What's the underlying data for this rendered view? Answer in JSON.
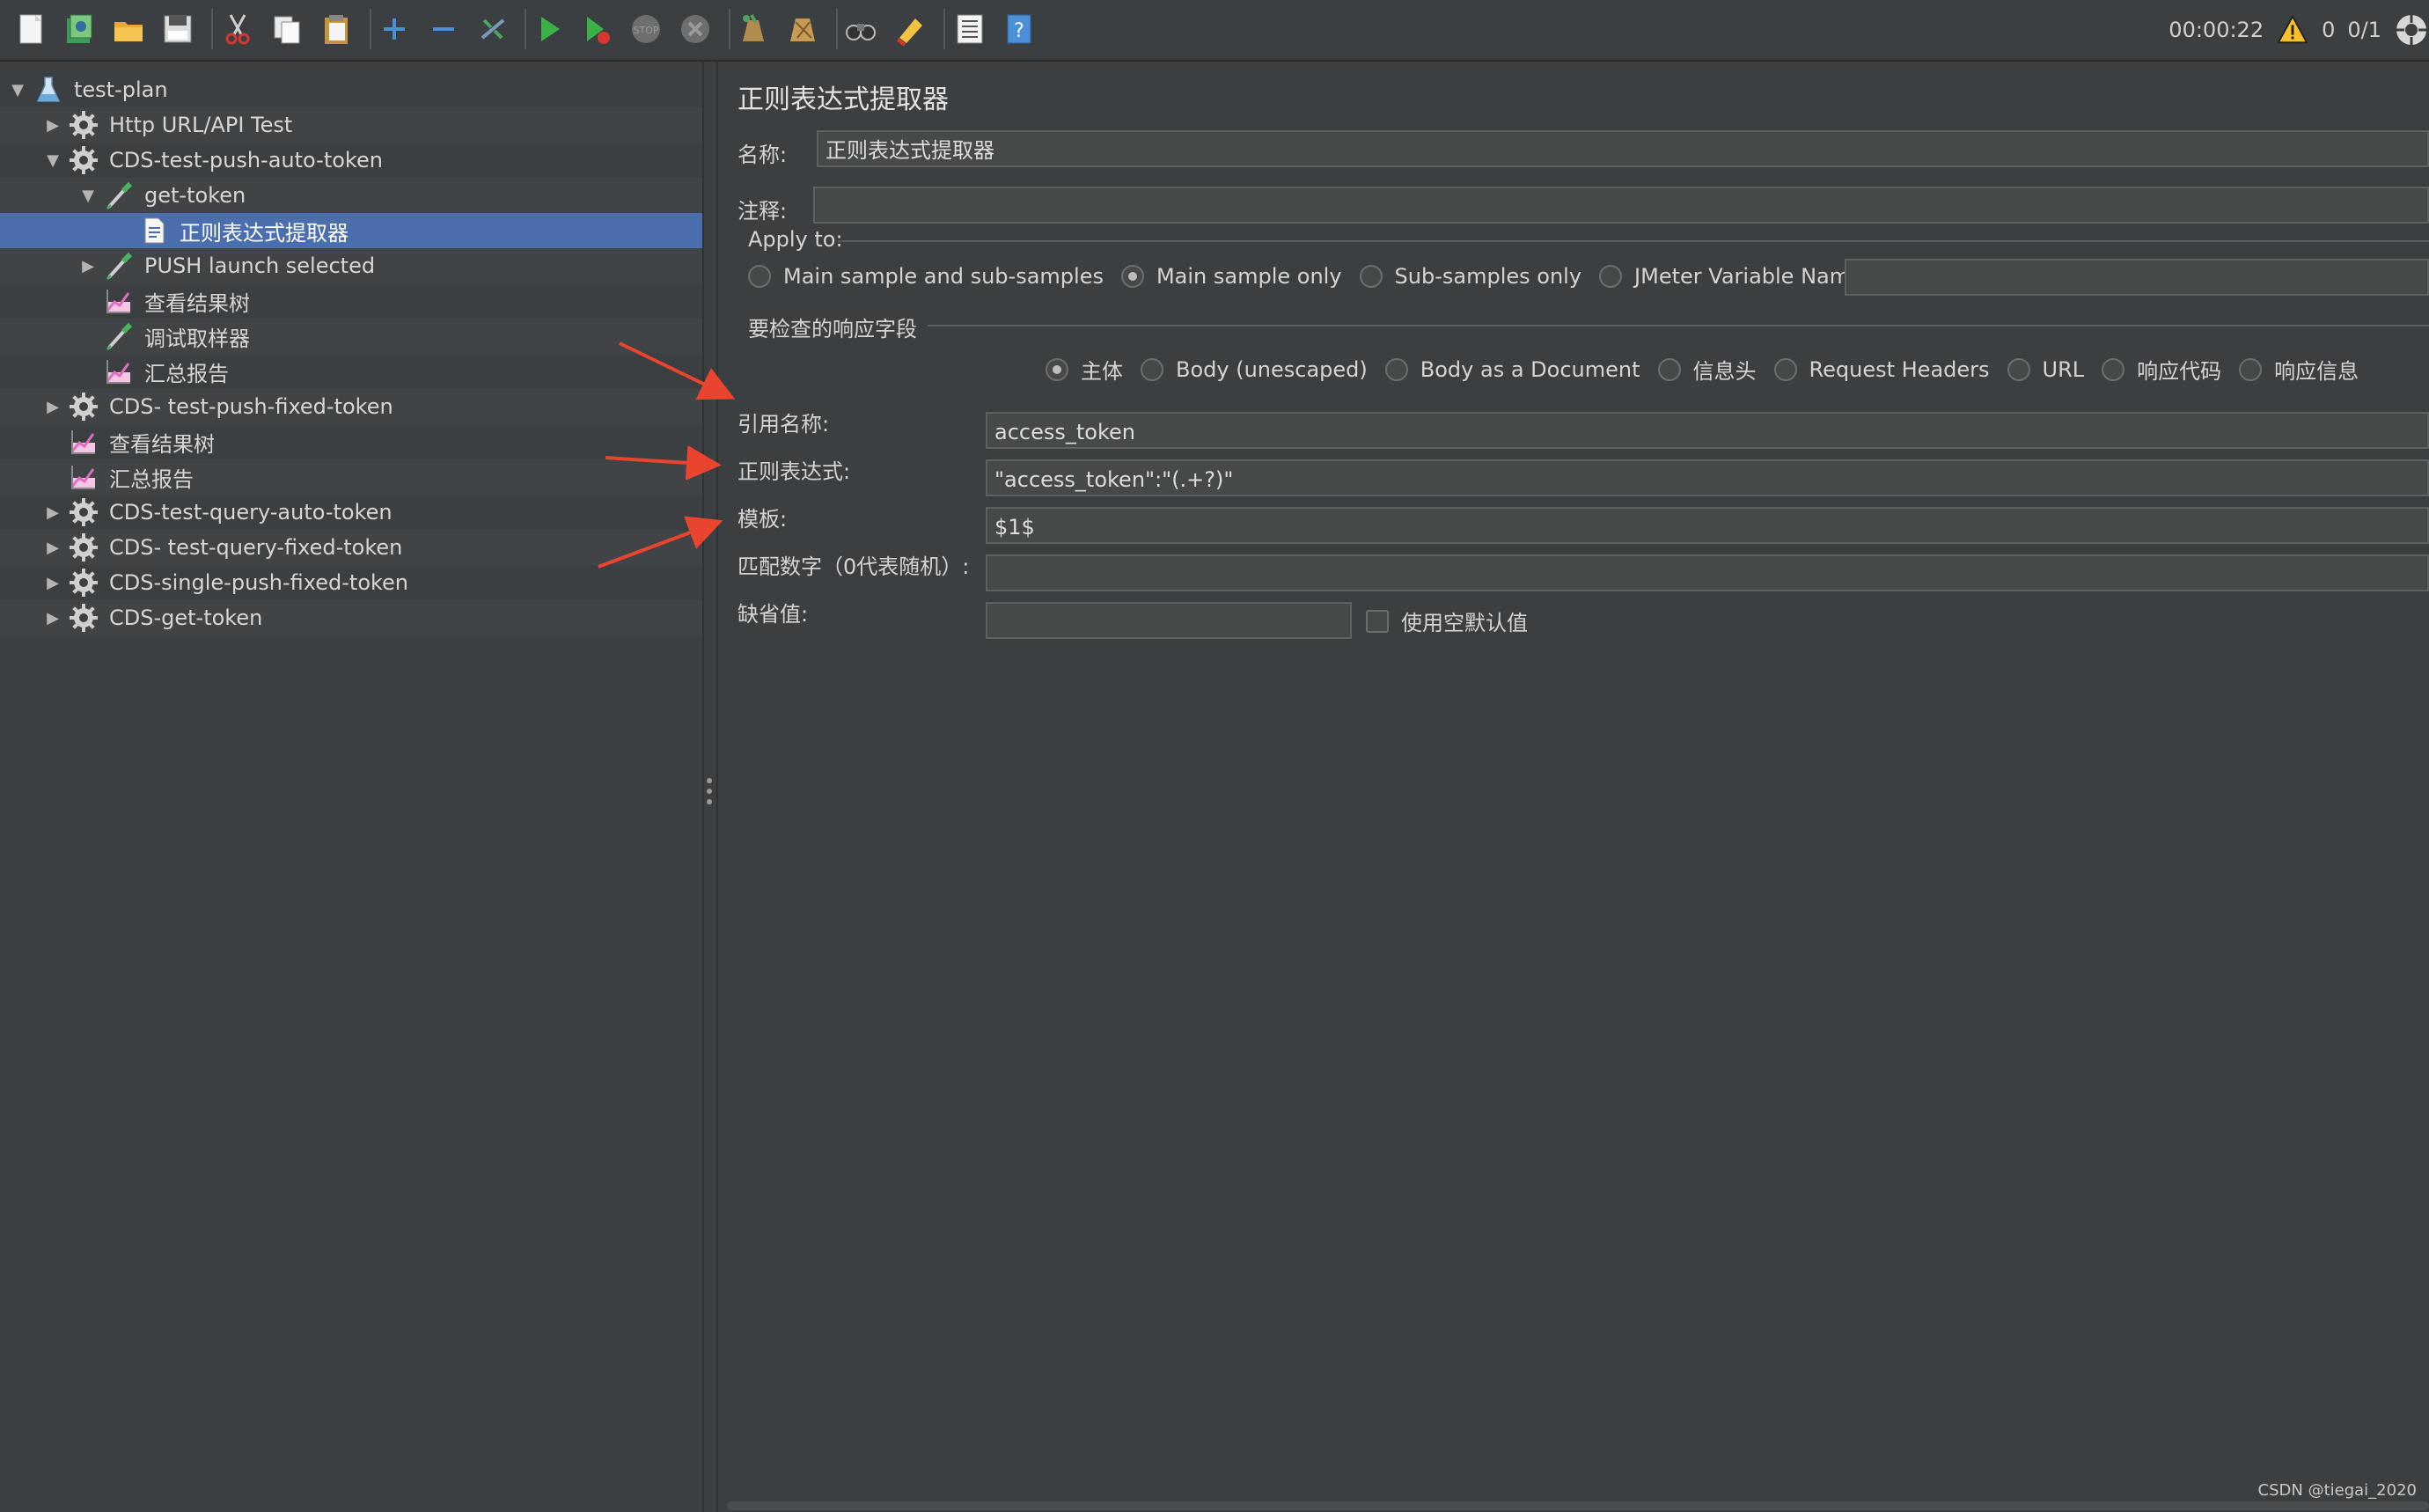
{
  "toolbar": {
    "buttons": [
      {
        "name": "new-icon"
      },
      {
        "name": "templates-icon"
      },
      {
        "name": "open-icon"
      },
      {
        "name": "save-icon"
      },
      {
        "name": "cut-icon"
      },
      {
        "name": "copy-icon"
      },
      {
        "name": "paste-icon"
      },
      {
        "name": "expand-icon"
      },
      {
        "name": "collapse-icon"
      },
      {
        "name": "toggle-icon"
      },
      {
        "name": "start-icon"
      },
      {
        "name": "start-no-pauses-icon"
      },
      {
        "name": "stop-icon"
      },
      {
        "name": "shutdown-icon"
      },
      {
        "name": "clear-icon"
      },
      {
        "name": "clear-all-icon"
      },
      {
        "name": "search-icon"
      },
      {
        "name": "reset-search-icon"
      },
      {
        "name": "function-helper-icon"
      },
      {
        "name": "help-icon"
      }
    ],
    "timer": "00:00:22",
    "warning_count": "0",
    "threads": "0/1"
  },
  "tree": {
    "items": [
      {
        "label": "test-plan",
        "icon": "flask-icon",
        "expanded": true
      },
      {
        "label": "Http URL/API Test",
        "icon": "gear-icon",
        "expanded": false
      },
      {
        "label": "CDS-test-push-auto-token",
        "icon": "gear-icon",
        "expanded": true
      },
      {
        "label": "get-token",
        "icon": "pipette-icon",
        "expanded": true
      },
      {
        "label": "正则表达式提取器",
        "icon": "document-icon",
        "selected": true
      },
      {
        "label": "PUSH launch selected",
        "icon": "pipette-icon",
        "expanded": false
      },
      {
        "label": "查看结果树",
        "icon": "chart-icon"
      },
      {
        "label": "调试取样器",
        "icon": "pipette-icon"
      },
      {
        "label": "汇总报告",
        "icon": "chart-icon"
      },
      {
        "label": "CDS- test-push-fixed-token",
        "icon": "gear-icon",
        "expanded": false
      },
      {
        "label": "查看结果树",
        "icon": "chart-icon"
      },
      {
        "label": "汇总报告",
        "icon": "chart-icon"
      },
      {
        "label": "CDS-test-query-auto-token",
        "icon": "gear-icon",
        "expanded": false
      },
      {
        "label": "CDS- test-query-fixed-token",
        "icon": "gear-icon",
        "expanded": false
      },
      {
        "label": "CDS-single-push-fixed-token",
        "icon": "gear-icon",
        "expanded": false
      },
      {
        "label": "CDS-get-token",
        "icon": "gear-icon",
        "expanded": false
      }
    ]
  },
  "editor": {
    "title": "正则表达式提取器",
    "name_label": "名称:",
    "name_value": "正则表达式提取器",
    "comment_label": "注释:",
    "comment_value": "",
    "apply_to": {
      "label": "Apply to:",
      "options": [
        "Main sample and sub-samples",
        "Main sample only",
        "Sub-samples only",
        "JMeter Variable Name to use"
      ],
      "selected_index": 1,
      "variable_value": ""
    },
    "field_check": {
      "label": "要检查的响应字段",
      "options": [
        "主体",
        "Body (unescaped)",
        "Body as a Document",
        "信息头",
        "Request Headers",
        "URL",
        "响应代码",
        "响应信息"
      ],
      "selected_index": 0
    },
    "ref_name_label": "引用名称:",
    "ref_name_value": "access_token",
    "regex_label": "正则表达式:",
    "regex_value": "\"access_token\":\"(.+?)\"",
    "template_label": "模板:",
    "template_value": "$1$",
    "match_no_label": "匹配数字（0代表随机）:",
    "match_no_value": "",
    "default_label": "缺省值:",
    "default_value": "",
    "use_empty_default_label": "使用空默认值",
    "use_empty_default_checked": false
  },
  "colors": {
    "background": "#3c3f41",
    "selection": "#4b6eaf",
    "annotation_arrow": "#e8442e"
  },
  "watermark": "CSDN @tiegai_2020"
}
